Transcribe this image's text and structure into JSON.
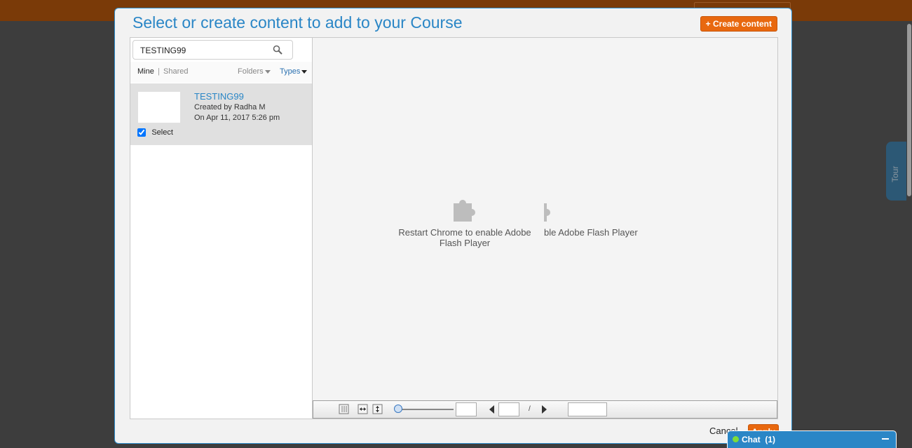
{
  "modal": {
    "title": "Select or create content to add to your Course",
    "create_button": "+ Create content"
  },
  "search": {
    "value": "TESTING99"
  },
  "filters": {
    "mine": "Mine",
    "separator": "|",
    "shared": "Shared",
    "folders": "Folders",
    "types": "Types"
  },
  "results": [
    {
      "title": "TESTING99",
      "created_by": "Created by Radha M",
      "date": "On Apr 11, 2017 5:26 pm",
      "select_label": "Select",
      "selected": true
    }
  ],
  "preview": {
    "plugin_message": "Restart Chrome to enable Adobe Flash Player",
    "plugin_message_partial": "ble Adobe Flash Player"
  },
  "viewer_toolbar": {
    "page_separator": "/"
  },
  "footer": {
    "cancel": "Cancel",
    "apply": "Apply"
  },
  "chat": {
    "label": "Chat",
    "count": "(1)"
  },
  "tour": {
    "label": "Tour"
  },
  "colors": {
    "accent_blue": "#2a86c6",
    "accent_orange": "#e8680f",
    "header_bar": "#7a3a08"
  }
}
